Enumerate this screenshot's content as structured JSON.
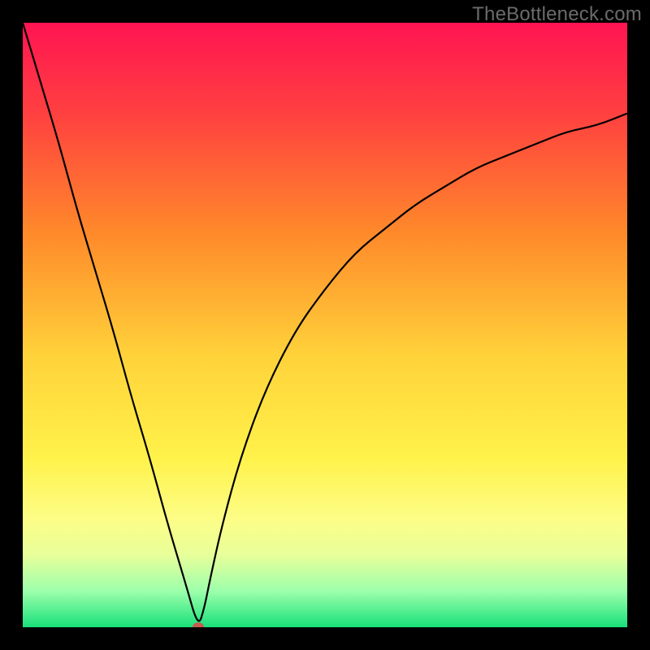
{
  "watermark": "TheBottleneck.com",
  "marker_color": "#c55b4d",
  "curve_color": "#000000",
  "chart_data": {
    "type": "line",
    "title": "",
    "xlabel": "",
    "ylabel": "",
    "xlim": [
      0,
      100
    ],
    "ylim": [
      0,
      100
    ],
    "x": [
      0,
      3,
      6,
      9,
      12,
      15,
      18,
      21,
      24,
      27,
      29,
      30,
      31,
      33,
      36,
      40,
      45,
      50,
      55,
      60,
      65,
      70,
      75,
      80,
      85,
      90,
      95,
      100
    ],
    "values": [
      100,
      90,
      80,
      69,
      59,
      49,
      38,
      28,
      17,
      7,
      0,
      3,
      8,
      17,
      28,
      39,
      49,
      56,
      62,
      66,
      70,
      73,
      76,
      78,
      80,
      82,
      83,
      85
    ],
    "series": [
      {
        "name": "bottleneck-curve",
        "x": [
          0,
          3,
          6,
          9,
          12,
          15,
          18,
          21,
          24,
          27,
          29,
          30,
          31,
          33,
          36,
          40,
          45,
          50,
          55,
          60,
          65,
          70,
          75,
          80,
          85,
          90,
          95,
          100
        ],
        "values": [
          100,
          90,
          80,
          69,
          59,
          49,
          38,
          28,
          17,
          7,
          0,
          3,
          8,
          17,
          28,
          39,
          49,
          56,
          62,
          66,
          70,
          73,
          76,
          78,
          80,
          82,
          83,
          85
        ]
      }
    ],
    "marker": {
      "x": 29,
      "y": 0
    },
    "gradient_stops": [
      {
        "offset": 0,
        "color": "#ff1452"
      },
      {
        "offset": 15,
        "color": "#ff4040"
      },
      {
        "offset": 35,
        "color": "#ff8a2a"
      },
      {
        "offset": 55,
        "color": "#ffd23a"
      },
      {
        "offset": 72,
        "color": "#fff24a"
      },
      {
        "offset": 82,
        "color": "#fdfd86"
      },
      {
        "offset": 88,
        "color": "#e8ff9a"
      },
      {
        "offset": 94,
        "color": "#9dffab"
      },
      {
        "offset": 100,
        "color": "#18e07a"
      }
    ]
  }
}
